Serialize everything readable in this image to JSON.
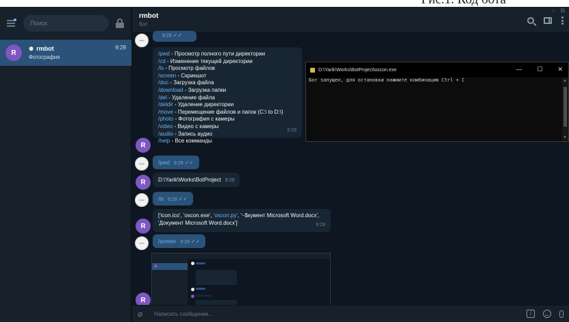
{
  "caption": "Рис.1. Код бота",
  "window": {
    "controls": [
      "–",
      "⧉"
    ]
  },
  "sidebar": {
    "search_placeholder": "Поиск",
    "chat": {
      "avatar": "R",
      "name": "rmbot",
      "preview": "Фотография",
      "time": "9:29"
    }
  },
  "header": {
    "title": "rmbot",
    "subtitle": "бот"
  },
  "messages": {
    "top_partial_time": "9:29",
    "help_lines": [
      {
        "cmd": "/pwd",
        "desc": " - Просмотр полного пути директории"
      },
      {
        "cmd": "/cd",
        "desc": " - Изменение текущей директории"
      },
      {
        "cmd": "/ls",
        "desc": " - Просмотр файлов"
      },
      {
        "cmd": "/screen",
        "desc": " - Скриншот"
      },
      {
        "cmd": "/doc",
        "desc": " - Загрузка файла"
      },
      {
        "cmd": "/download",
        "desc": " - Загрузка папки"
      },
      {
        "cmd": "/del",
        "desc": " - Удаление файла"
      },
      {
        "cmd": "/deldir",
        "desc": " - Удаление директории"
      },
      {
        "cmd": "/move",
        "desc": " - Перемещение файлов и папок (C:\\ to D:\\)"
      },
      {
        "cmd": "/photo",
        "desc": " - Фотография с камеры"
      },
      {
        "cmd": "/video",
        "desc": " - Видео с камеры"
      },
      {
        "cmd": "/audio",
        "desc": " - Запись аудио"
      },
      {
        "cmd": "/help",
        "desc": " - Все комманды"
      }
    ],
    "help_time": "9:29",
    "pwd_cmd": "/pwd",
    "pwd_time": "9:29",
    "pwd_reply": "D:\\Yarik\\Works\\BotProject",
    "pwd_reply_time": "9:29",
    "ls_cmd": "/ls",
    "ls_time": "9:29",
    "ls_reply_1": "['icon.ico', 'oscon.exe', ",
    "ls_reply_1_link": "'oscon.py'",
    "ls_reply_1_end": ", '~$кумент Microsoft Word.docx',",
    "ls_reply_2": "'Документ Microsoft Word.docx']",
    "ls_reply_time": "9:29",
    "screen_cmd": "/screen",
    "screen_time": "9:29",
    "avatar_letter": "R",
    "checks": "✓✓"
  },
  "console": {
    "title": "D:\\Yarik\\Works\\BotProject\\oscon.exe",
    "controls": [
      "—",
      "☐",
      "✕"
    ],
    "output": "Бот запущен, для остановки нажмите комбинацию Ctrl + C"
  },
  "composer": {
    "placeholder": "Написать сообщение...",
    "cmd_icon": "/"
  }
}
